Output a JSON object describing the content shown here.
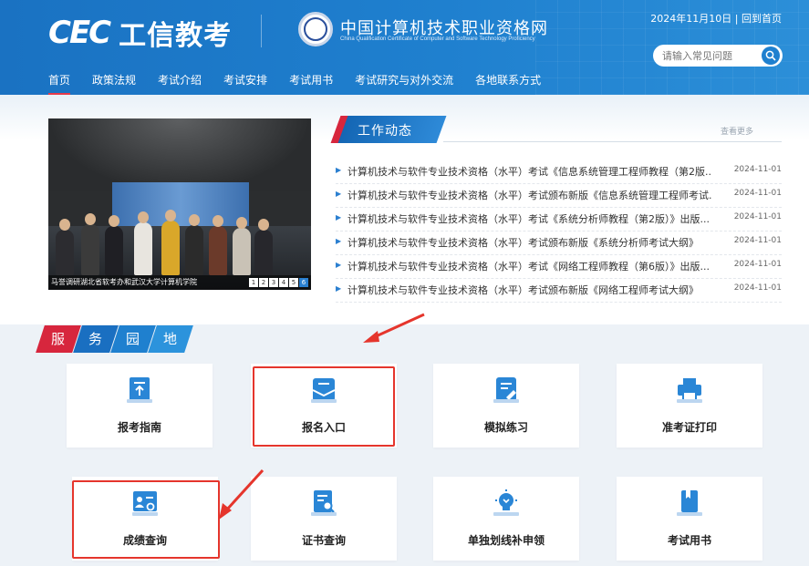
{
  "header": {
    "logo_mark": "CEC",
    "logo_text": "工信教考",
    "site_title": "中国计算机技术职业资格网",
    "site_subtitle": "China Qualification Certificate of Computer and Software Technology Proficiency",
    "date": "2024年11月10日",
    "home_link": "| 回到首页",
    "search_placeholder": "请输入常见问题"
  },
  "nav": {
    "items": [
      "首页",
      "政策法规",
      "考试介绍",
      "考试安排",
      "考试用书",
      "考试研究与对外交流",
      "各地联系方式"
    ],
    "active_index": 0
  },
  "slideshow": {
    "caption": "马誉调研湖北省软考办和武汉大学计算机学院",
    "pages": [
      "1",
      "2",
      "3",
      "4",
      "5",
      "6"
    ],
    "active_page": 6
  },
  "news": {
    "title": "工作动态",
    "more": "查看更多",
    "items": [
      {
        "title": "计算机技术与软件专业技术资格（水平）考试《信息系统管理工程师教程（第2版...",
        "date": "2024-11-01"
      },
      {
        "title": "计算机技术与软件专业技术资格（水平）考试颁布新版《信息系统管理工程师考试...",
        "date": "2024-11-01"
      },
      {
        "title": "计算机技术与软件专业技术资格（水平）考试《系统分析师教程（第2版）》出版...",
        "date": "2024-11-01"
      },
      {
        "title": "计算机技术与软件专业技术资格（水平）考试颁布新版《系统分析师考试大纲》",
        "date": "2024-11-01"
      },
      {
        "title": "计算机技术与软件专业技术资格（水平）考试《网络工程师教程（第6版）》出版...",
        "date": "2024-11-01"
      },
      {
        "title": "计算机技术与软件专业技术资格（水平）考试颁布新版《网络工程师考试大纲》",
        "date": "2024-11-01"
      }
    ]
  },
  "services": {
    "heading": [
      "服",
      "务",
      "园",
      "地"
    ],
    "cards": [
      {
        "label": "报考指南",
        "icon": "guide-icon"
      },
      {
        "label": "报名入口",
        "icon": "registration-icon"
      },
      {
        "label": "模拟练习",
        "icon": "practice-icon"
      },
      {
        "label": "准考证打印",
        "icon": "printer-icon"
      },
      {
        "label": "成绩查询",
        "icon": "score-query-icon"
      },
      {
        "label": "证书查询",
        "icon": "certificate-query-icon"
      },
      {
        "label": "单独划线补申领",
        "icon": "lightbulb-icon"
      },
      {
        "label": "考试用书",
        "icon": "book-icon"
      }
    ]
  },
  "colors": {
    "brand_blue": "#1f80cf",
    "accent_red": "#e5352c",
    "icon_blue": "#2a86d6"
  }
}
